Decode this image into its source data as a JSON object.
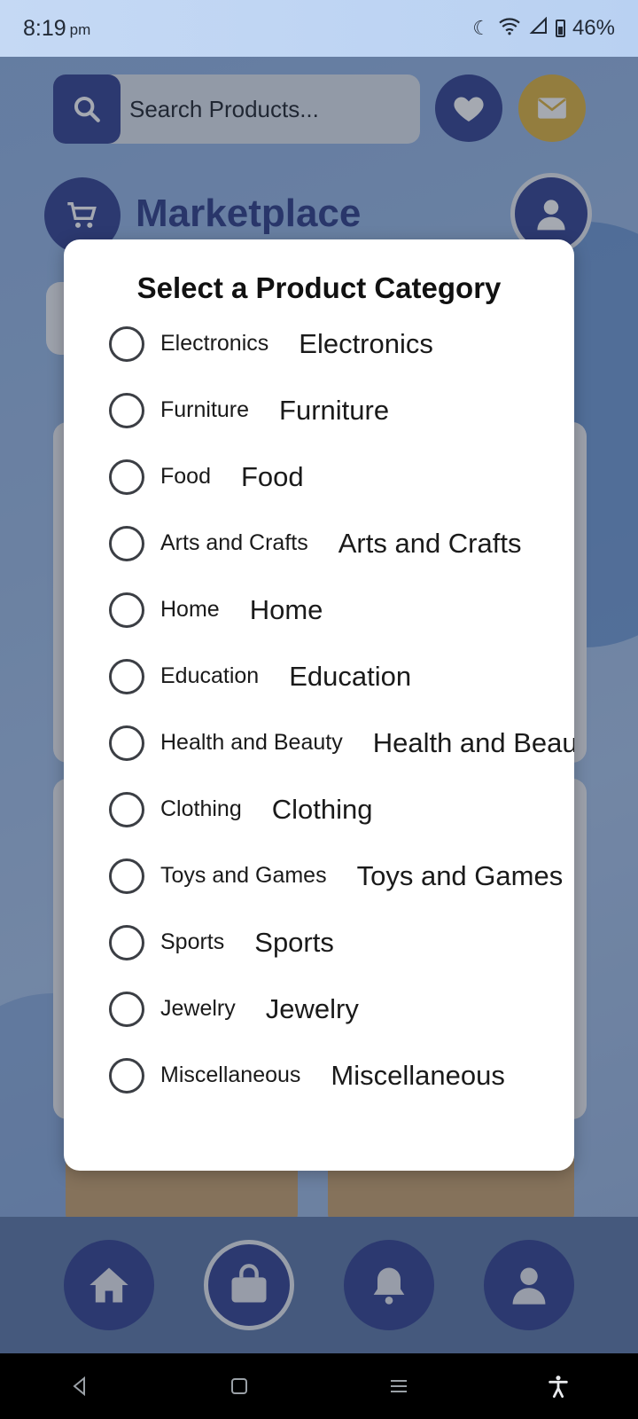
{
  "status_bar": {
    "time": "8:19",
    "ampm": "pm",
    "battery": "46%"
  },
  "search": {
    "placeholder": "Search Products..."
  },
  "app": {
    "title": "Marketplace"
  },
  "dialog": {
    "title": "Select a Product Category",
    "options": [
      {
        "label": "Electronics",
        "value": "Electronics"
      },
      {
        "label": "Furniture",
        "value": "Furniture"
      },
      {
        "label": "Food",
        "value": "Food"
      },
      {
        "label": "Arts and Crafts",
        "value": "Arts and Crafts"
      },
      {
        "label": "Home",
        "value": "Home"
      },
      {
        "label": "Education",
        "value": "Education"
      },
      {
        "label": "Health and Beauty",
        "value": "Health and Beauty"
      },
      {
        "label": "Clothing",
        "value": "Clothing"
      },
      {
        "label": "Toys and Games",
        "value": "Toys and Games"
      },
      {
        "label": "Sports",
        "value": "Sports"
      },
      {
        "label": "Jewelry",
        "value": "Jewelry"
      },
      {
        "label": "Miscellaneous",
        "value": "Miscellaneous"
      }
    ]
  },
  "tabs": [
    {
      "icon": "home-icon",
      "active": false
    },
    {
      "icon": "shopping-bag-icon",
      "active": true
    },
    {
      "icon": "bell-icon",
      "active": false
    },
    {
      "icon": "profile-icon",
      "active": false
    }
  ],
  "colors": {
    "primary": "#2f3f8f",
    "accent": "#e1b33a",
    "dialog_bg": "#ffffff"
  }
}
